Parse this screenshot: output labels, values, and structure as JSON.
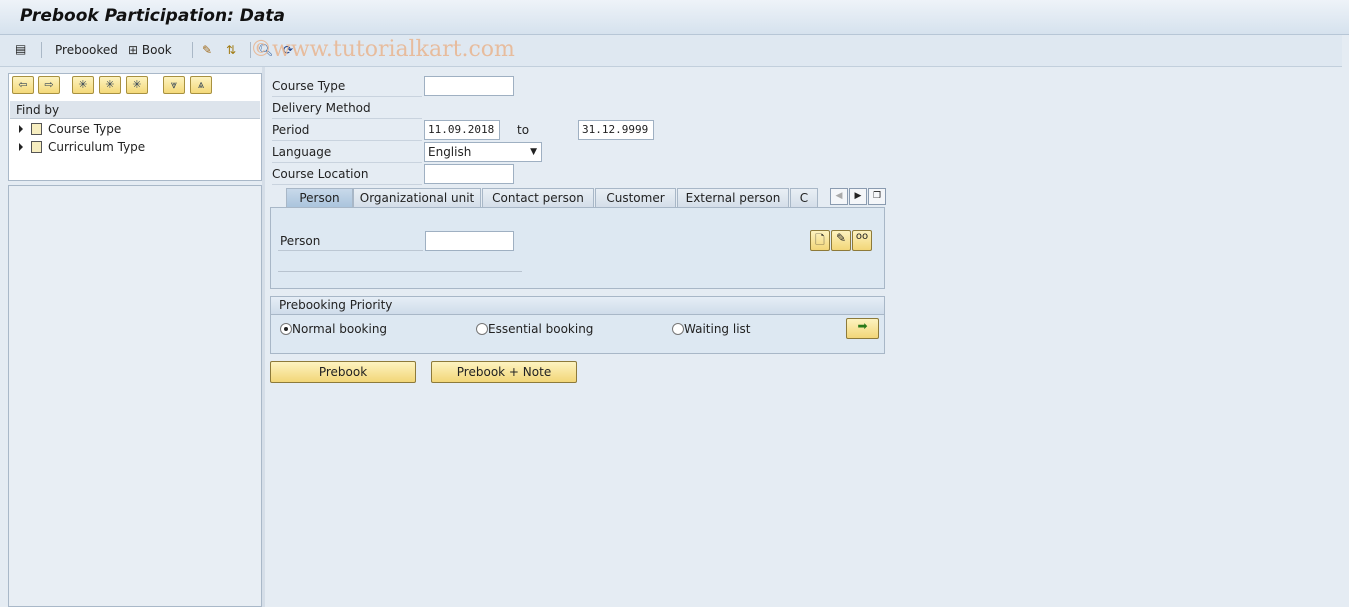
{
  "window": {
    "title": "Prebook Participation: Data"
  },
  "toolbar": {
    "prebooked_label": "Prebooked",
    "book_label": "Book",
    "watermark": "©www.tutorialkart.com"
  },
  "navigator": {
    "find_by": "Find by",
    "items": [
      {
        "label": "Course Type"
      },
      {
        "label": "Curriculum Type"
      }
    ]
  },
  "form": {
    "course_type": {
      "label": "Course Type",
      "value": ""
    },
    "delivery_method": {
      "label": "Delivery Method"
    },
    "period": {
      "label": "Period",
      "from": "11.09.2018",
      "to_label": "to",
      "to": "31.12.9999"
    },
    "language": {
      "label": "Language",
      "value": "English"
    },
    "course_location": {
      "label": "Course Location",
      "value": ""
    }
  },
  "tabs": [
    {
      "label": "Person",
      "active": true
    },
    {
      "label": "Organizational unit"
    },
    {
      "label": "Contact person"
    },
    {
      "label": "Customer"
    },
    {
      "label": "External person"
    },
    {
      "label": "C"
    }
  ],
  "person": {
    "label": "Person",
    "value": ""
  },
  "priority": {
    "title": "Prebooking Priority",
    "options": [
      {
        "label": "Normal booking",
        "selected": true
      },
      {
        "label": "Essential booking"
      },
      {
        "label": "Waiting list"
      }
    ]
  },
  "actions": {
    "prebook": "Prebook",
    "prebook_note": "Prebook + Note"
  }
}
